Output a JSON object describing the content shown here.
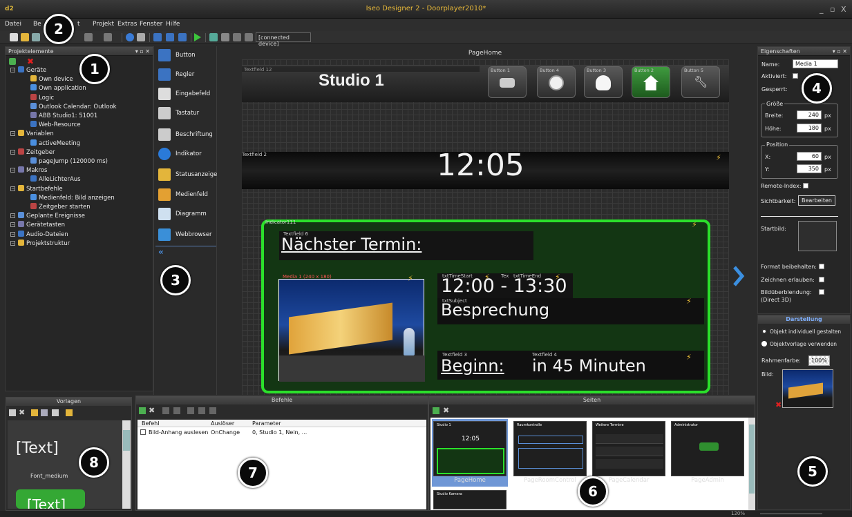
{
  "window": {
    "logo": "d2",
    "title": "Iseo Designer 2 - Doorplayer2010*",
    "min": "_",
    "max": "▫",
    "close": "X"
  },
  "menu": [
    "Datei",
    "Be",
    "t",
    "Projekt",
    "Extras",
    "Fenster",
    "Hilfe"
  ],
  "toolbar": {
    "device": "[connected device]"
  },
  "project_panel": {
    "title": "Projektelemente",
    "tree": [
      {
        "label": "Geräte",
        "level": 0
      },
      {
        "label": "Own device",
        "level": 1
      },
      {
        "label": "Own application",
        "level": 1
      },
      {
        "label": "Logic",
        "level": 1
      },
      {
        "label": "Outlook Calendar: Outlook",
        "level": 1
      },
      {
        "label": "ABB Studio1: 51001",
        "level": 1
      },
      {
        "label": "Web-Resource",
        "level": 1
      },
      {
        "label": "Variablen",
        "level": 0
      },
      {
        "label": "activeMeeting",
        "level": 1
      },
      {
        "label": "Zeitgeber",
        "level": 0
      },
      {
        "label": "pageJump (120000 ms)",
        "level": 1
      },
      {
        "label": "Makros",
        "level": 0
      },
      {
        "label": "AlleLichterAus",
        "level": 1
      },
      {
        "label": "Startbefehle",
        "level": 0
      },
      {
        "label": "Medienfeld: Bild anzeigen",
        "level": 1
      },
      {
        "label": "Zeitgeber starten",
        "level": 1
      },
      {
        "label": "Geplante Ereignisse",
        "level": 0
      },
      {
        "label": "Gerätetasten",
        "level": 0
      },
      {
        "label": "Audio-Dateien",
        "level": 0
      },
      {
        "label": "Projektstruktur",
        "level": 0
      }
    ]
  },
  "toolbox": [
    "Button",
    "Regler",
    "Eingabefeld",
    "Tastatur",
    "Beschriftung",
    "Indikator",
    "Statusanzeige",
    "Medienfeld",
    "Diagramm",
    "Webbrowser"
  ],
  "canvas": {
    "page_name": "PageHome",
    "tf12_label": "Textfield 12",
    "studio": "Studio 1",
    "buttons": [
      "Button 1",
      "Button 4",
      "Button 3",
      "Button 2",
      "Button 5"
    ],
    "tf2_label": "Textfield 2",
    "clock": "12:05",
    "indicator_label": "Indicator111",
    "tf6_label": "Textfield 6",
    "next_meeting": "Nächster Termin:",
    "media_label": "Media 1 (240 x 180)",
    "ts_label": "txtTimeStart",
    "te_label": "txtTimeEnd",
    "tex_label": "Tex",
    "time_range": "12:00 - 13:30",
    "subj_label": "txtSubject",
    "subject": "Besprechung",
    "tf3_label": "Textfield 3",
    "tf4_label": "Textfield 4",
    "begin": "Beginn:",
    "in45": "in 45 Minuten"
  },
  "properties": {
    "title": "Eigenschaften",
    "name_label": "Name:",
    "name_value": "Media 1",
    "activated_label": "Aktiviert:",
    "locked_label": "Gesperrt:",
    "size_group": "Größe",
    "width_label": "Breite:",
    "width_value": "240",
    "height_label": "Höhe:",
    "height_value": "180",
    "unit": "px",
    "pos_group": "Position",
    "x_label": "X:",
    "x_value": "60",
    "y_label": "Y:",
    "y_value": "350",
    "remote_index": "Remote-Index:",
    "visibility": "Sichtbarkeit:",
    "edit_btn": "Bearbeiten",
    "startbild": "Startbild:",
    "keep_format": "Format beibehalten:",
    "allow_draw": "Zeichnen erlauben:",
    "blend": "Bildüberblendung:",
    "blend2": "(Direct 3D)"
  },
  "appearance": {
    "title": "Darstellung",
    "opt1": "Objekt individuell gestalten",
    "opt2": "Objektvorlage verwenden",
    "frame_color": "Rahmenfarbe:",
    "frame_pct": "100%",
    "image": "Bild:"
  },
  "templates": {
    "title": "Vorlagen",
    "sample": "[Text]",
    "font_label": "Font_medium",
    "sample2": "[Text]"
  },
  "commands": {
    "title": "Befehle",
    "headers": [
      "Befehl",
      "Auslöser",
      "Parameter"
    ],
    "rows": [
      [
        "Bild-Anhang auslesen",
        "OnChange",
        "0, Studio 1, Nein, ..."
      ]
    ]
  },
  "pages": {
    "title": "Seiten",
    "items": [
      "PageHome",
      "PageRoomControl",
      "PageCalendar",
      "PageAdmin"
    ],
    "thumb_titles": [
      "Studio 1",
      "Raumkontrolle",
      "Weitere Termine",
      "Administrator",
      "Studio Kamera"
    ]
  },
  "status": {
    "zoom": "120%"
  },
  "callouts": [
    "1",
    "2",
    "3",
    "4",
    "5",
    "6",
    "7",
    "8"
  ]
}
